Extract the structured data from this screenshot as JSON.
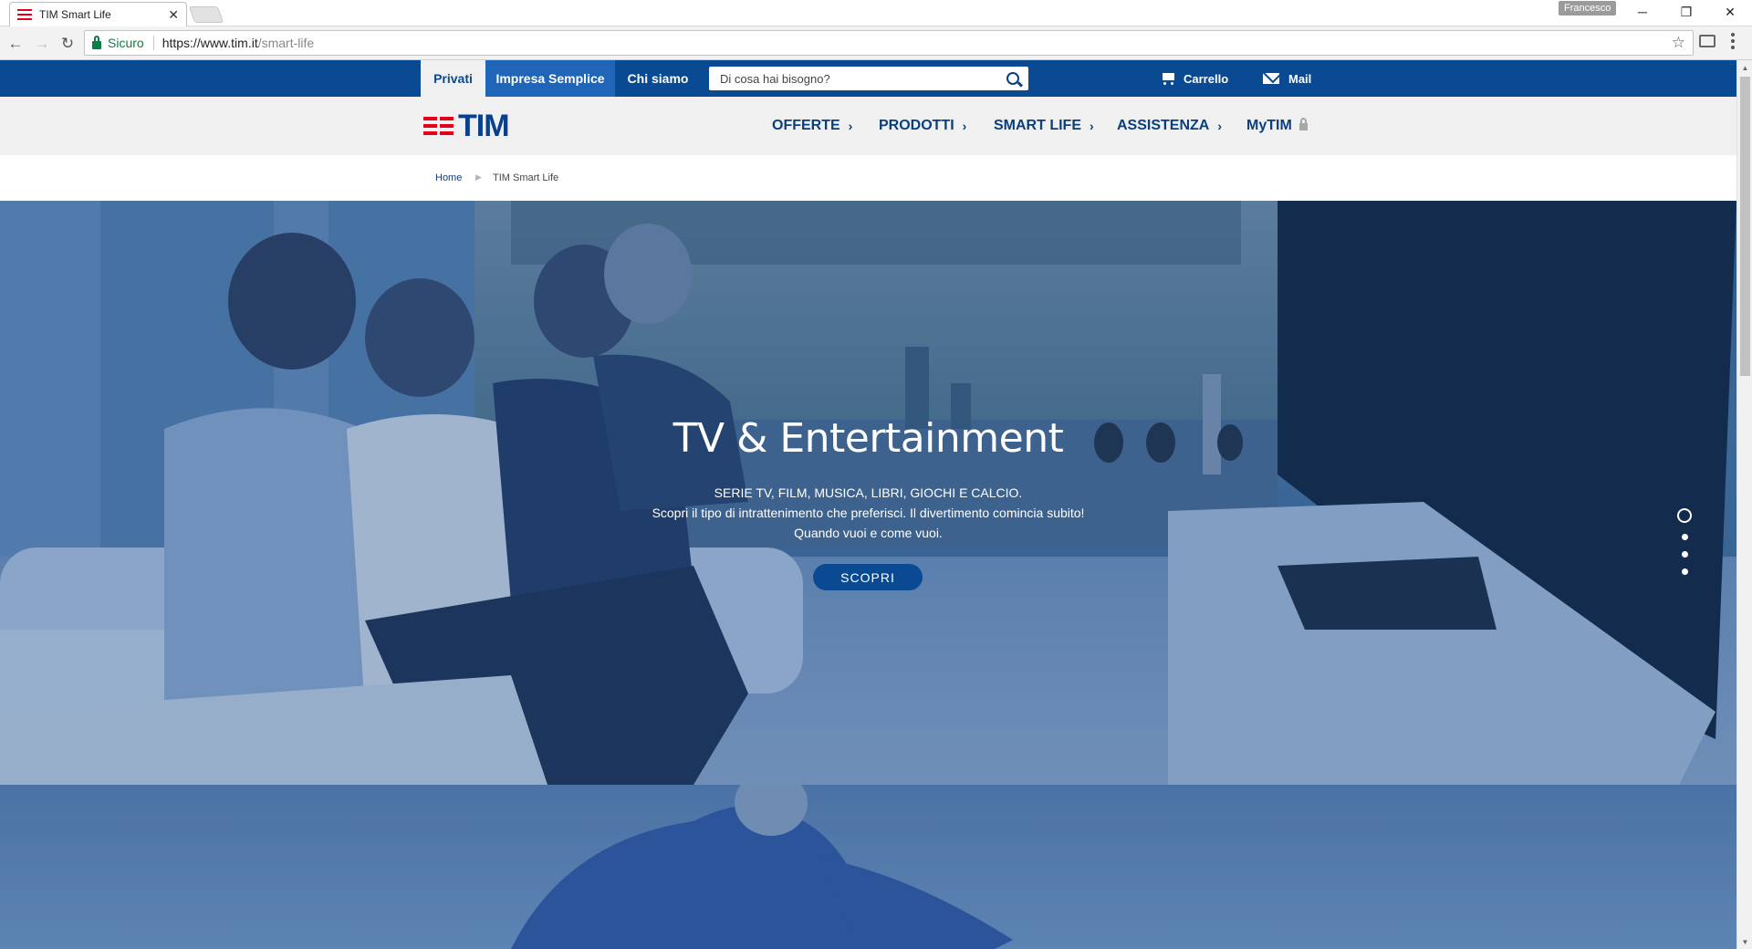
{
  "browser": {
    "tab_title": "TIM Smart Life",
    "tab_close": "✕",
    "profile_name": "Francesco",
    "secure_label": "Sicuro",
    "url_host": "https://www.tim.it",
    "url_path": "/smart-life",
    "window_controls": {
      "minimize": "─",
      "restore": "❐",
      "close": "✕"
    },
    "nav": {
      "back": "←",
      "forward": "→",
      "reload": "↻",
      "star": "☆"
    }
  },
  "topbar": {
    "segments": [
      "Privati",
      "Impresa Semplice",
      "Chi siamo"
    ],
    "search_placeholder": "Di cosa hai bisogno?",
    "cart_label": "Carrello",
    "mail_label": "Mail"
  },
  "mainnav": {
    "logo_text": "TIM",
    "items": [
      "OFFERTE",
      "PRODOTTI",
      "SMART LIFE",
      "ASSISTENZA",
      "MyTIM"
    ],
    "chevron": "›"
  },
  "breadcrumb": {
    "home": "Home",
    "separator": "▶",
    "current": "TIM Smart Life"
  },
  "hero": {
    "title": "TV & Entertainment",
    "lines": [
      "SERIE TV, FILM, MUSICA, LIBRI, GIOCHI E CALCIO.",
      "Scopri il tipo di intrattenimento che preferisci. Il divertimento comincia subito!",
      "Quando vuoi e come vuoi."
    ],
    "button_label": "SCOPRI",
    "slide_count": 4,
    "active_slide": 1
  },
  "colors": {
    "brand_blue": "#0a4a93",
    "impresa_blue": "#1f66b9",
    "tim_red": "#e2001a",
    "nav_text": "#0a3f7e"
  }
}
